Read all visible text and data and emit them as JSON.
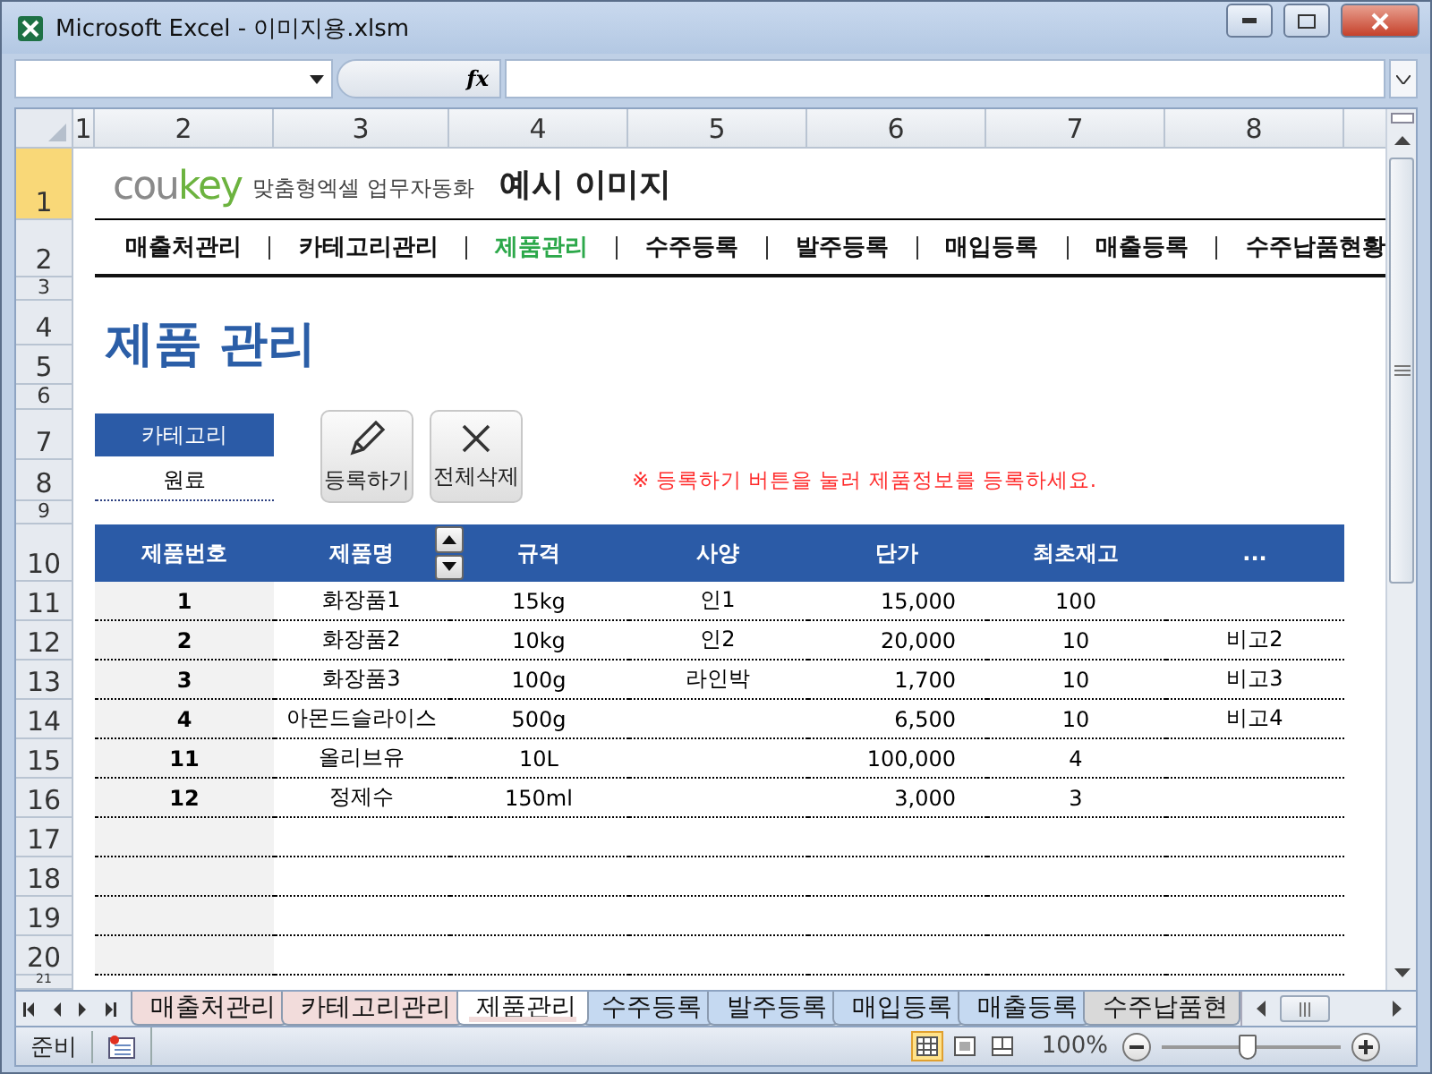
{
  "window": {
    "title": "Microsoft Excel - 이미지용.xlsm"
  },
  "formula_bar": {
    "function_label": "fx"
  },
  "column_headers": [
    "1",
    "2",
    "3",
    "4",
    "5",
    "6",
    "7",
    "8"
  ],
  "row_headers": [
    {
      "label": "1",
      "selected": true
    },
    {
      "label": "2",
      "selected": false
    },
    {
      "label": "3",
      "selected": false
    },
    {
      "label": "4",
      "selected": false
    },
    {
      "label": "5",
      "selected": false
    },
    {
      "label": "6",
      "selected": false
    },
    {
      "label": "7",
      "selected": false
    },
    {
      "label": "8",
      "selected": false
    },
    {
      "label": "9",
      "selected": false
    },
    {
      "label": "10",
      "selected": false
    },
    {
      "label": "11",
      "selected": false
    },
    {
      "label": "12",
      "selected": false
    },
    {
      "label": "13",
      "selected": false
    },
    {
      "label": "14",
      "selected": false
    },
    {
      "label": "15",
      "selected": false
    },
    {
      "label": "16",
      "selected": false
    },
    {
      "label": "17",
      "selected": false
    },
    {
      "label": "18",
      "selected": false
    },
    {
      "label": "19",
      "selected": false
    },
    {
      "label": "20",
      "selected": false
    },
    {
      "label": "21",
      "selected": false
    }
  ],
  "header": {
    "logo": [
      "cou",
      "key"
    ],
    "tagline": "맞춤형엑셀 업무자동화",
    "title": "예시 이미지"
  },
  "nav": [
    {
      "label": "매출처관리",
      "selected": false
    },
    {
      "label": "카테고리관리",
      "selected": false
    },
    {
      "label": "제품관리",
      "selected": true
    },
    {
      "label": "수주등록",
      "selected": false
    },
    {
      "label": "발주등록",
      "selected": false
    },
    {
      "label": "매입등록",
      "selected": false
    },
    {
      "label": "매출등록",
      "selected": false
    },
    {
      "label": "수주납품현황",
      "selected": false
    }
  ],
  "page_title": "제품 관리",
  "category": {
    "label": "카테고리",
    "value": "원료"
  },
  "buttons": [
    {
      "kind": "edit",
      "label": "등록하기"
    },
    {
      "kind": "delete",
      "label": "전체삭제"
    }
  ],
  "notice": "※ 등록하기 버튼을 눌러 제품정보를 등록하세요.",
  "table": {
    "columns": [
      "제품번호",
      "제품명",
      "규격",
      "사양",
      "단가",
      "최초재고",
      "..."
    ],
    "rows": [
      {
        "number": "1",
        "name": "화장품1",
        "spec": "15kg",
        "option": "인1",
        "price": "15,000",
        "stock": "100"
      },
      {
        "number": "2",
        "name": "화장품2",
        "spec": "10kg",
        "option": "인2",
        "price": "20,000",
        "stock": "10",
        "column_7": "비고2"
      },
      {
        "number": "3",
        "name": "화장품3",
        "spec": "100g",
        "option": "라인박",
        "price": "1,700",
        "stock": "10",
        "column_7": "비고3"
      },
      {
        "number": "4",
        "name": "아몬드슬라이스",
        "spec": "500g",
        "price": "6,500",
        "stock": "10",
        "column_7": "비고4"
      },
      {
        "number": "11",
        "name": "올리브유",
        "spec": "10L",
        "price": "100,000",
        "stock": "4"
      },
      {
        "number": "12",
        "name": "정제수",
        "spec": "150ml",
        "price": "3,000",
        "stock": "3"
      }
    ]
  },
  "sheet_tabs": [
    {
      "label": "매출처관리",
      "selected": false,
      "color": "#f2dcdb"
    },
    {
      "label": "카테고리관리",
      "selected": false,
      "color": "#f2dcdb"
    },
    {
      "label": "제품관리",
      "selected": true,
      "color": "#f2dcdb"
    },
    {
      "label": "수주등록",
      "selected": false,
      "color": "#c5d9f1"
    },
    {
      "label": "발주등록",
      "selected": false,
      "color": "#c5d9f1"
    },
    {
      "label": "매입등록",
      "selected": false,
      "color": "#c5d9f1"
    },
    {
      "label": "매출등록",
      "selected": false,
      "color": "#c5d9f1"
    },
    {
      "label": "수주납품현",
      "selected": false,
      "color": "#d9d9d9"
    }
  ],
  "status_bar": {
    "mode": "준비",
    "views": [
      {
        "kind": "normal",
        "selected": true
      },
      {
        "kind": "page_layout",
        "selected": false
      },
      {
        "kind": "page_break",
        "selected": false
      }
    ],
    "zoom": "100%",
    "zoom_slider": {
      "level": 0.5
    }
  }
}
